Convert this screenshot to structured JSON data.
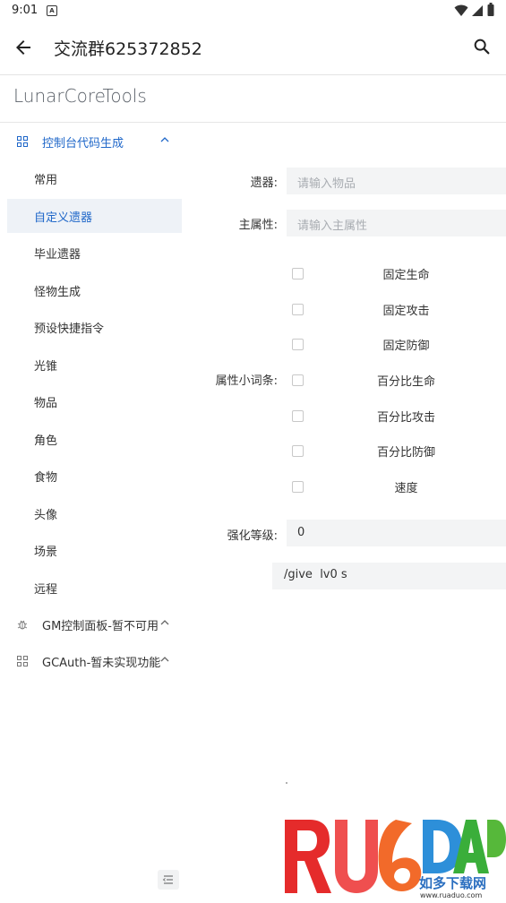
{
  "status_bar": {
    "time": "9:01",
    "app_icon": "A"
  },
  "app_bar": {
    "title": "交流群625372852",
    "back_icon": "arrow-left-icon",
    "search_icon": "search-icon"
  },
  "brand": "LunarCoreTools",
  "sidebar": {
    "group_console": {
      "label": "控制台代码生成",
      "icon": "grid-icon"
    },
    "items": [
      "常用",
      "自定义遗器",
      "毕业遗器",
      "怪物生成",
      "预设快捷指令",
      "光锥",
      "物品",
      "角色",
      "食物",
      "头像",
      "场景",
      "远程"
    ],
    "active_index": 1,
    "group_gm": {
      "label": "GM控制面板-暂不可用",
      "icon": "bug-icon"
    },
    "group_gcauth": {
      "label": "GCAuth-暂未实现功能",
      "icon": "grid-icon"
    }
  },
  "form": {
    "relic_label": "遗器:",
    "relic_placeholder": "请输入物品",
    "main_stat_label": "主属性:",
    "main_stat_placeholder": "请输入主属性",
    "substat_label": "属性小词条:",
    "substats": [
      "固定生命",
      "固定攻击",
      "固定防御",
      "百分比生命",
      "百分比攻击",
      "百分比防御",
      "速度"
    ],
    "level_label": "强化等级:",
    "level_value": "0",
    "output": "/give  lv0 s"
  },
  "watermark": {
    "text": "RUADADO",
    "cn": "如多下载网",
    "url": "www.ruaduo.com"
  },
  "colors": {
    "accent": "#1f67c9",
    "active_bg": "#eef2f7",
    "input_bg": "#f3f4f5"
  }
}
